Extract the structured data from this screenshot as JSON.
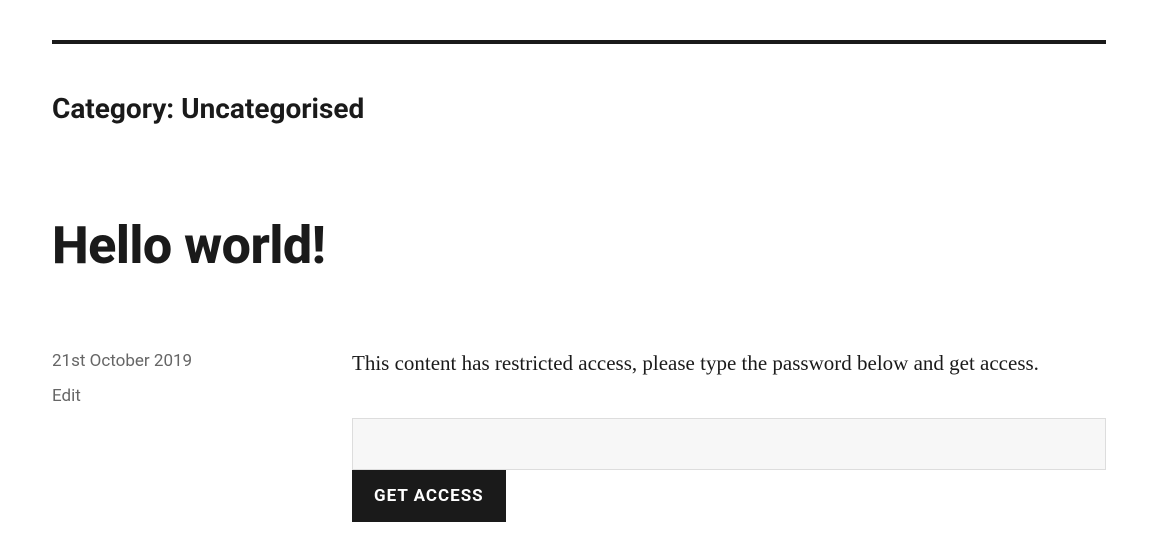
{
  "category": {
    "prefix": "Category: ",
    "name": "Uncategorised"
  },
  "post": {
    "title": "Hello world!",
    "date": "21st October 2019",
    "edit_label": "Edit",
    "restricted_message": "This content has restricted access, please type the password below and get access.",
    "button_label": "Get Access"
  }
}
